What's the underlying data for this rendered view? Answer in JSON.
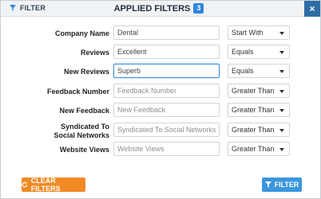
{
  "titlebar": {
    "filter_label": "FILTER",
    "title": "APPLIED FILTERS",
    "count": "3",
    "close_symbol": "×"
  },
  "rows": [
    {
      "label": "Company Name",
      "value": "Dental",
      "placeholder": "Company Name",
      "operator": "Start With"
    },
    {
      "label": "Reviews",
      "value": "Excellent",
      "placeholder": "Reviews",
      "operator": "Equals"
    },
    {
      "label": "New Reviews",
      "value": "Superb",
      "placeholder": "New Reviews",
      "operator": "Equals"
    },
    {
      "label": "Feedback Number",
      "value": "",
      "placeholder": "Feedback Number",
      "operator": "Greater Than"
    },
    {
      "label": "New Feedback",
      "value": "",
      "placeholder": "New Feedback",
      "operator": "Greater Than"
    },
    {
      "label_line1": "Syndicated To",
      "label_line2": "Social Networks",
      "value": "",
      "placeholder": "Syndicated To Social Networks",
      "operator": "Greater Than"
    },
    {
      "label": "Website Views",
      "value": "",
      "placeholder": "Website Views",
      "operator": "Greater Than"
    }
  ],
  "buttons": {
    "clear_label": "CLEAR FILTERS",
    "filter_label": "FILTER"
  },
  "icons": {
    "funnel": "funnel-icon",
    "refresh": "refresh-icon",
    "close": "close-icon",
    "caret": "chevron-down-icon"
  },
  "colors": {
    "accent_blue": "#2e86de",
    "close_bg": "#2e6da4",
    "clear_orange": "#f08a24",
    "filter_blue": "#3a96dd",
    "focus_border": "#3b8dde"
  }
}
